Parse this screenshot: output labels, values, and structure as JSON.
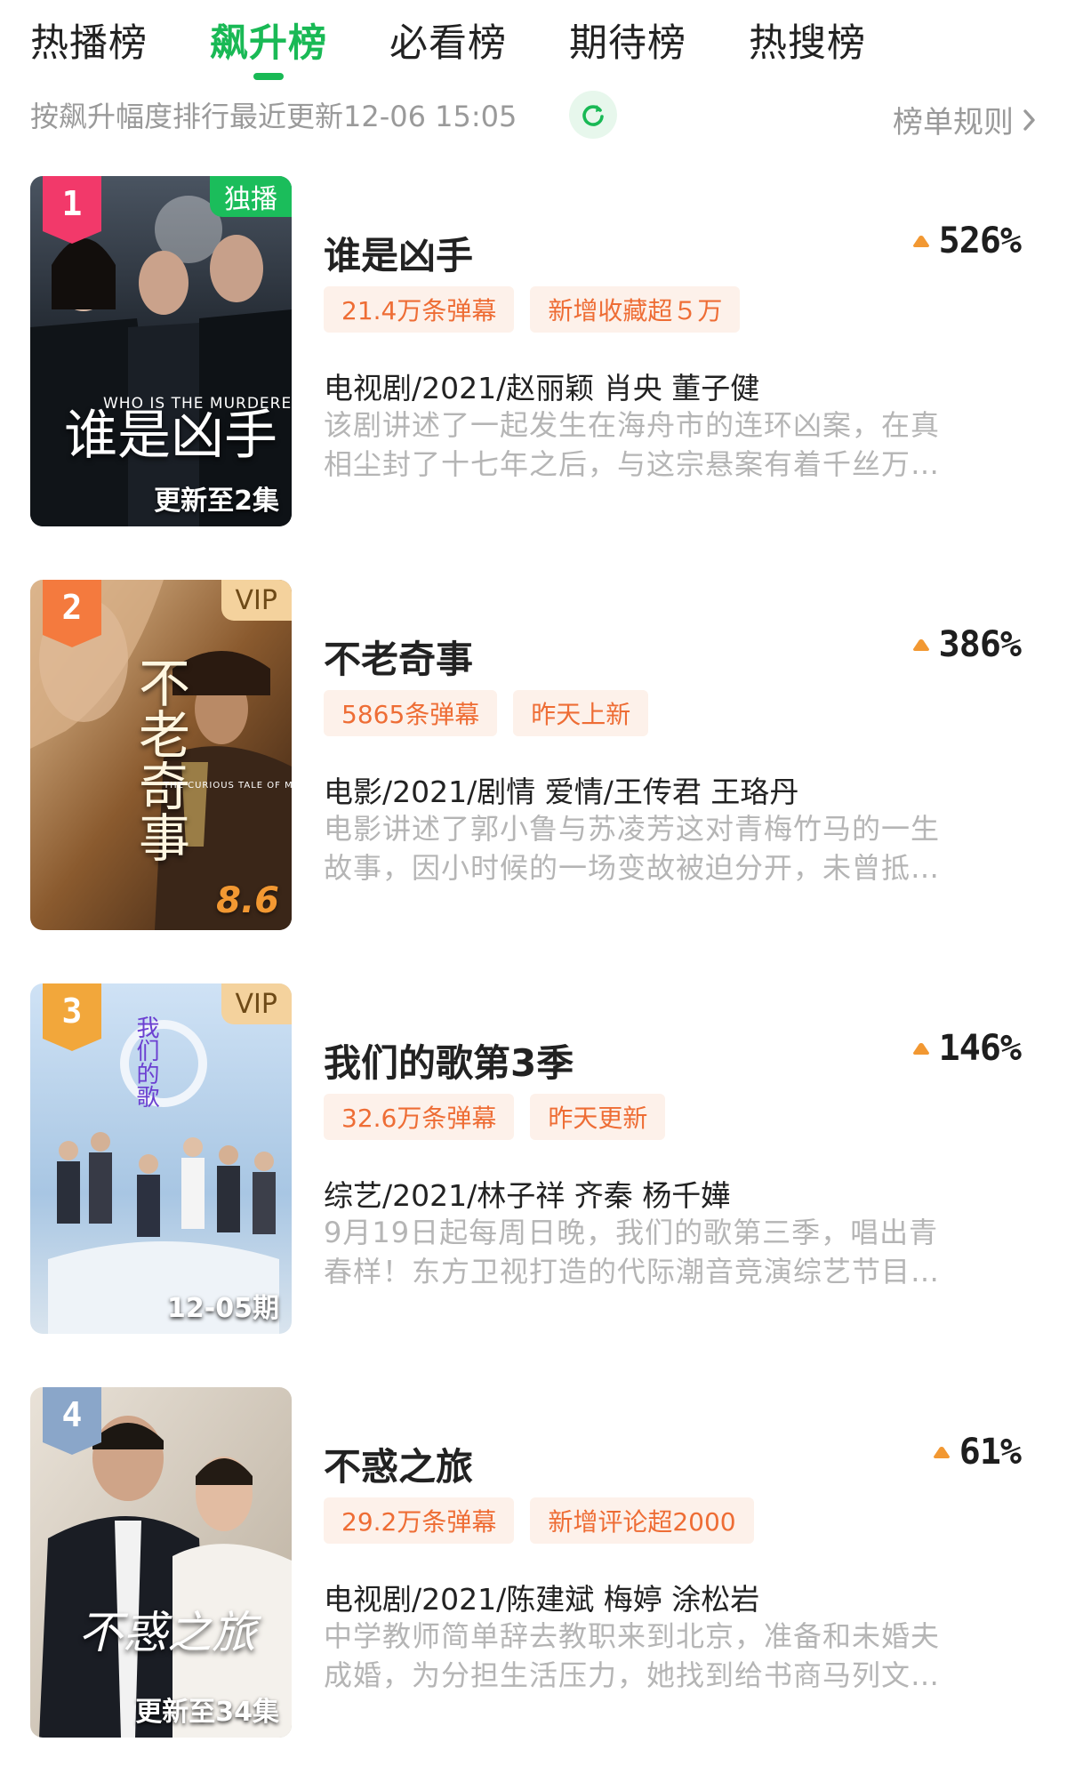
{
  "tabs": [
    {
      "label": "热播榜",
      "active": false
    },
    {
      "label": "飙升榜",
      "active": true
    },
    {
      "label": "必看榜",
      "active": false
    },
    {
      "label": "期待榜",
      "active": false
    },
    {
      "label": "热搜榜",
      "active": false
    }
  ],
  "subbar": {
    "sort_info": "按飙升幅度排行最近更新12-06 15:05",
    "rules_label": "榜单规则"
  },
  "colors": {
    "accent": "#19b955",
    "tag_text": "#ee6d35",
    "tag_bg": "#fdf1ea",
    "growth_arrow": "#f29832"
  },
  "items": [
    {
      "rank": "1",
      "corner_tag": "独播",
      "poster_title": "谁是凶手",
      "poster_sub": "WHO IS THE MURDERER",
      "poster_bottom": "更新至2集",
      "title": "谁是凶手",
      "growth": "526%",
      "tags": [
        "21.4万条弹幕",
        "新增收藏超５万"
      ],
      "meta": "电视剧/2021/赵丽颖 肖央 董子健",
      "desc_line1": "该剧讲述了一起发生在海舟市的连环凶案，在真",
      "desc_line2": "相尘封了十七年之后，与这宗悬案有着千丝万…"
    },
    {
      "rank": "2",
      "corner_tag": "VIP",
      "poster_title": "不老奇事",
      "poster_sub": "THE CURIOUS TALE OF MR.GUO",
      "poster_bottom": "8.6",
      "title": "不老奇事",
      "growth": "386%",
      "tags": [
        "5865条弹幕",
        "昨天上新"
      ],
      "meta": "电影/2021/剧情 爱情/王传君 王珞丹",
      "desc_line1": "电影讲述了郭小鲁与苏凌芳这对青梅竹马的一生",
      "desc_line2": "故事，因小时候的一场变故被迫分开，未曾抵…"
    },
    {
      "rank": "3",
      "corner_tag": "VIP",
      "poster_title": "我们的歌",
      "poster_sub": "",
      "poster_bottom": "12-05期",
      "title": "我们的歌第3季",
      "growth": "146%",
      "tags": [
        "32.6万条弹幕",
        "昨天更新"
      ],
      "meta": "综艺/2021/林子祥 齐秦 杨千嬅",
      "desc_line1": "9月19日起每周日晚，我们的歌第三季，唱出青",
      "desc_line2": "春样！东方卫视打造的代际潮音竞演综艺节目…"
    },
    {
      "rank": "4",
      "corner_tag": "",
      "poster_title": "不惑之旅",
      "poster_sub": "",
      "poster_bottom": "更新至34集",
      "title": "不惑之旅",
      "growth": "61%",
      "tags": [
        "29.2万条弹幕",
        "新增评论超2000"
      ],
      "meta": "电视剧/2021/陈建斌 梅婷 涂松岩",
      "desc_line1": "中学教师简单辞去教职来到北京，准备和未婚夫",
      "desc_line2": "成婚，为分担生活压力，她找到给书商马列文…"
    }
  ]
}
